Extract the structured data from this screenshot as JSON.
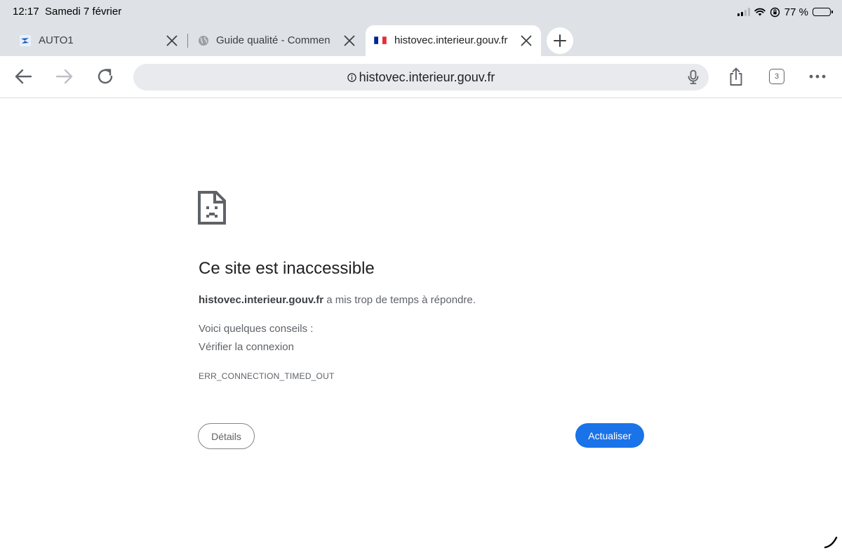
{
  "status_bar": {
    "time": "12:17",
    "date": "Samedi 7 février",
    "battery_text": "77 %",
    "battery_level": 0.77
  },
  "tabs": [
    {
      "title": "AUTO1",
      "favicon": "auto1-logo-icon",
      "active": false
    },
    {
      "title": "Guide qualité - Commen",
      "favicon": "globe-icon",
      "active": false
    },
    {
      "title": "histovec.interieur.gouv.fr",
      "favicon": "french-flag-icon",
      "active": true
    }
  ],
  "toolbar": {
    "url": "histovec.interieur.gouv.fr",
    "tab_count": "3"
  },
  "error": {
    "title": "Ce site est inaccessible",
    "host": "histovec.interieur.gouv.fr",
    "message": "a mis trop de temps à répondre.",
    "tips_heading": "Voici quelques conseils :",
    "tip_1": "Vérifier la connexion",
    "code": "ERR_CONNECTION_TIMED_OUT",
    "details_label": "Détails",
    "reload_label": "Actualiser"
  },
  "colors": {
    "chrome_bg": "#dee1e6",
    "accent": "#1a73e8",
    "text_secondary": "#5f6368"
  }
}
